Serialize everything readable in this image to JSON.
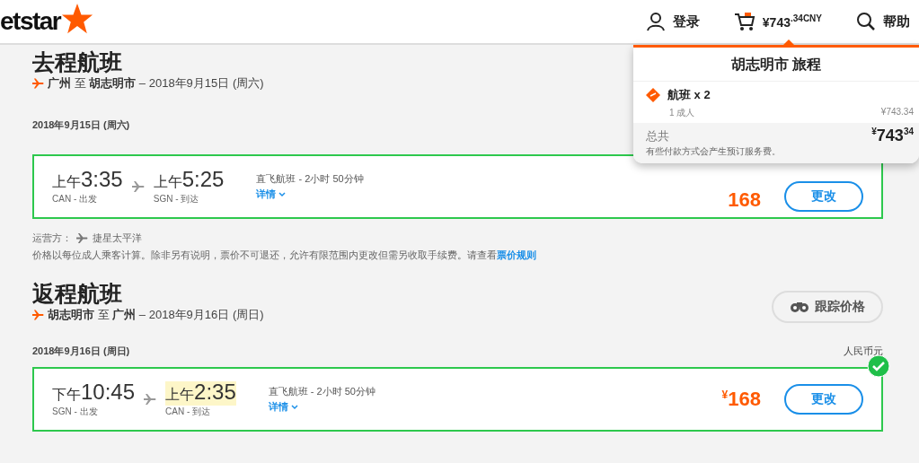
{
  "header": {
    "logo": "etstar",
    "login": "登录",
    "cart": "¥743$^{.34CNY}$",
    "help": "帮助"
  },
  "cart_dropdown": {
    "title": "胡志明市 旅程",
    "item": {
      "label": "航班 x 2",
      "passengers": "1 成人",
      "price": "¥743.34"
    },
    "total_label": "总共",
    "total": "$^{¥}$743$^{34}$",
    "note": "有些付款方式会产生预订服务费。"
  },
  "sections": [
    {
      "title": "去程航班",
      "route": "**广州** 至 **胡志明市** – 2018年9月15日 (周六)",
      "date": "2018年9月15日 (周六)",
      "flight": {
        "dep_period": "上午",
        "dep_time": "3:35",
        "dep_label": "CAN - 出发",
        "arr_period": "上午",
        "arr_time": "5:25",
        "arr_label": "SGN - 到达",
        "arr_highlighted": false,
        "info": "直飞航班 - 2小时 50分钟",
        "details": "详情",
        "price": "168",
        "button": "更改",
        "selected": true,
        "checkmark": false
      },
      "operator_label": "运营方：",
      "operator": "捷星太平洋",
      "note": "价格以每位成人乘客计算。除非另有说明，票价不可退还，允许有限范围内更改但需另收取手续费。请查看",
      "note_link": "票价规则"
    },
    {
      "title": "返程航班",
      "route": "**胡志明市** 至 **广州** – 2018年9月16日 (周日)",
      "track_button": "跟踪价格",
      "date": "2018年9月16日 (周日)",
      "currency": "人民币元",
      "flight": {
        "dep_period": "下午",
        "dep_time": "10:45",
        "dep_label": "SGN - 出发",
        "arr_period": "上午",
        "arr_time": "2:35",
        "arr_label": "CAN - 到达",
        "arr_highlighted": true,
        "info": "直飞航班 - 2小时 50分钟",
        "details": "详情",
        "price": "$^{¥}$168",
        "button": "更改",
        "selected": true,
        "checkmark": true
      }
    }
  ]
}
